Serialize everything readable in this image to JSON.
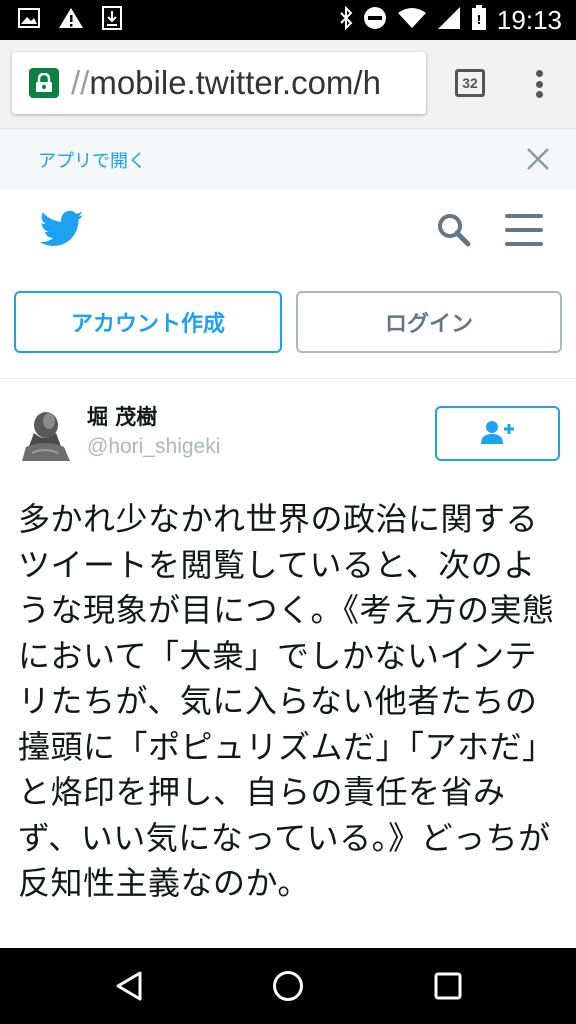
{
  "status_bar": {
    "time": "19:13",
    "icons": [
      "image-icon",
      "warning-icon",
      "download-icon",
      "bluetooth-icon",
      "do-not-disturb-icon",
      "wifi-icon",
      "signal-icon",
      "battery-icon"
    ]
  },
  "browser": {
    "url_fade": "//",
    "url": "mobile.twitter.com/h",
    "tab_count": "32"
  },
  "app_banner": {
    "open_in_app": "アプリで開く"
  },
  "buttons": {
    "signup": "アカウント作成",
    "login": "ログイン"
  },
  "tweet": {
    "author_name": "堀 茂樹",
    "author_handle": "@hori_shigeki",
    "text": "多かれ少なかれ世界の政治に関するツイートを閲覧していると、次のような現象が目につく。《考え方の実態において「大衆」でしかないインテリたちが、気に入らない他者たちの擡頭に「ポピュリズムだ」「アホだ」と烙印を押し、自らの責任を省みず、いい気になっている。》どっちが反知性主義なのか。"
  },
  "colors": {
    "twitter_blue": "#1da1f2",
    "gray": "#657786",
    "border_gray": "#aab8c2"
  }
}
